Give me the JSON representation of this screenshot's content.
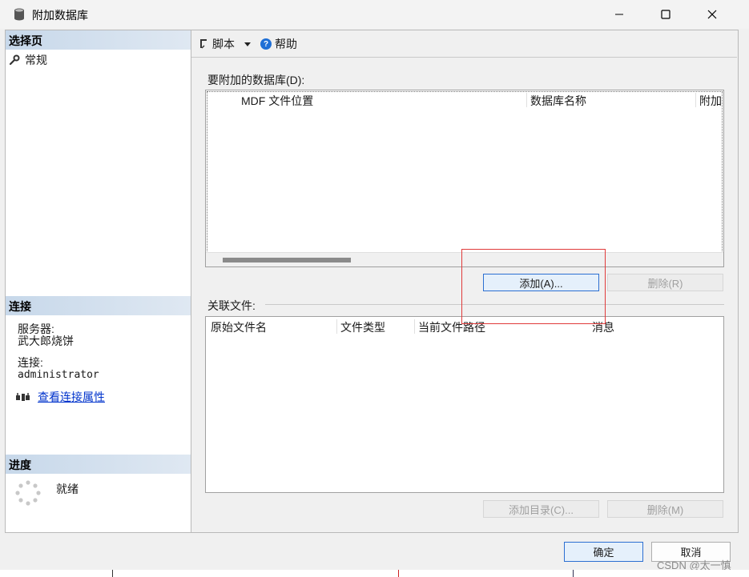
{
  "window": {
    "title": "附加数据库",
    "icon": "database-icon"
  },
  "left": {
    "select_page_header": "选择页",
    "nav": [
      {
        "label": "常规",
        "icon": "wrench-icon"
      }
    ],
    "connection_header": "连接",
    "server_label": "服务器:",
    "server_value": "武大郎烧饼",
    "connection_label": "连接:",
    "connection_value": "administrator",
    "view_props_link": "查看连接属性",
    "progress_header": "进度",
    "progress_status": "就绪"
  },
  "toolbar": {
    "script_label": "脚本",
    "help_label": "帮助"
  },
  "attach": {
    "label": "要附加的数据库(D):",
    "columns": [
      "MDF 文件位置",
      "数据库名称",
      "附加"
    ],
    "add_button": "添加(A)...",
    "remove_button": "删除(R)"
  },
  "related": {
    "label": "关联文件:",
    "columns": [
      "原始文件名",
      "文件类型",
      "当前文件路径",
      "消息"
    ],
    "add_catalog_button": "添加目录(C)...",
    "remove_button": "删除(M)"
  },
  "footer": {
    "ok_button": "确定",
    "cancel_button": "取消"
  },
  "watermark": "CSDN @太一慎",
  "colors": {
    "accent": "#2c6fd1",
    "highlight": "#e03a3a",
    "header_gradient": "#c7d8ea",
    "link": "#0033cc"
  }
}
